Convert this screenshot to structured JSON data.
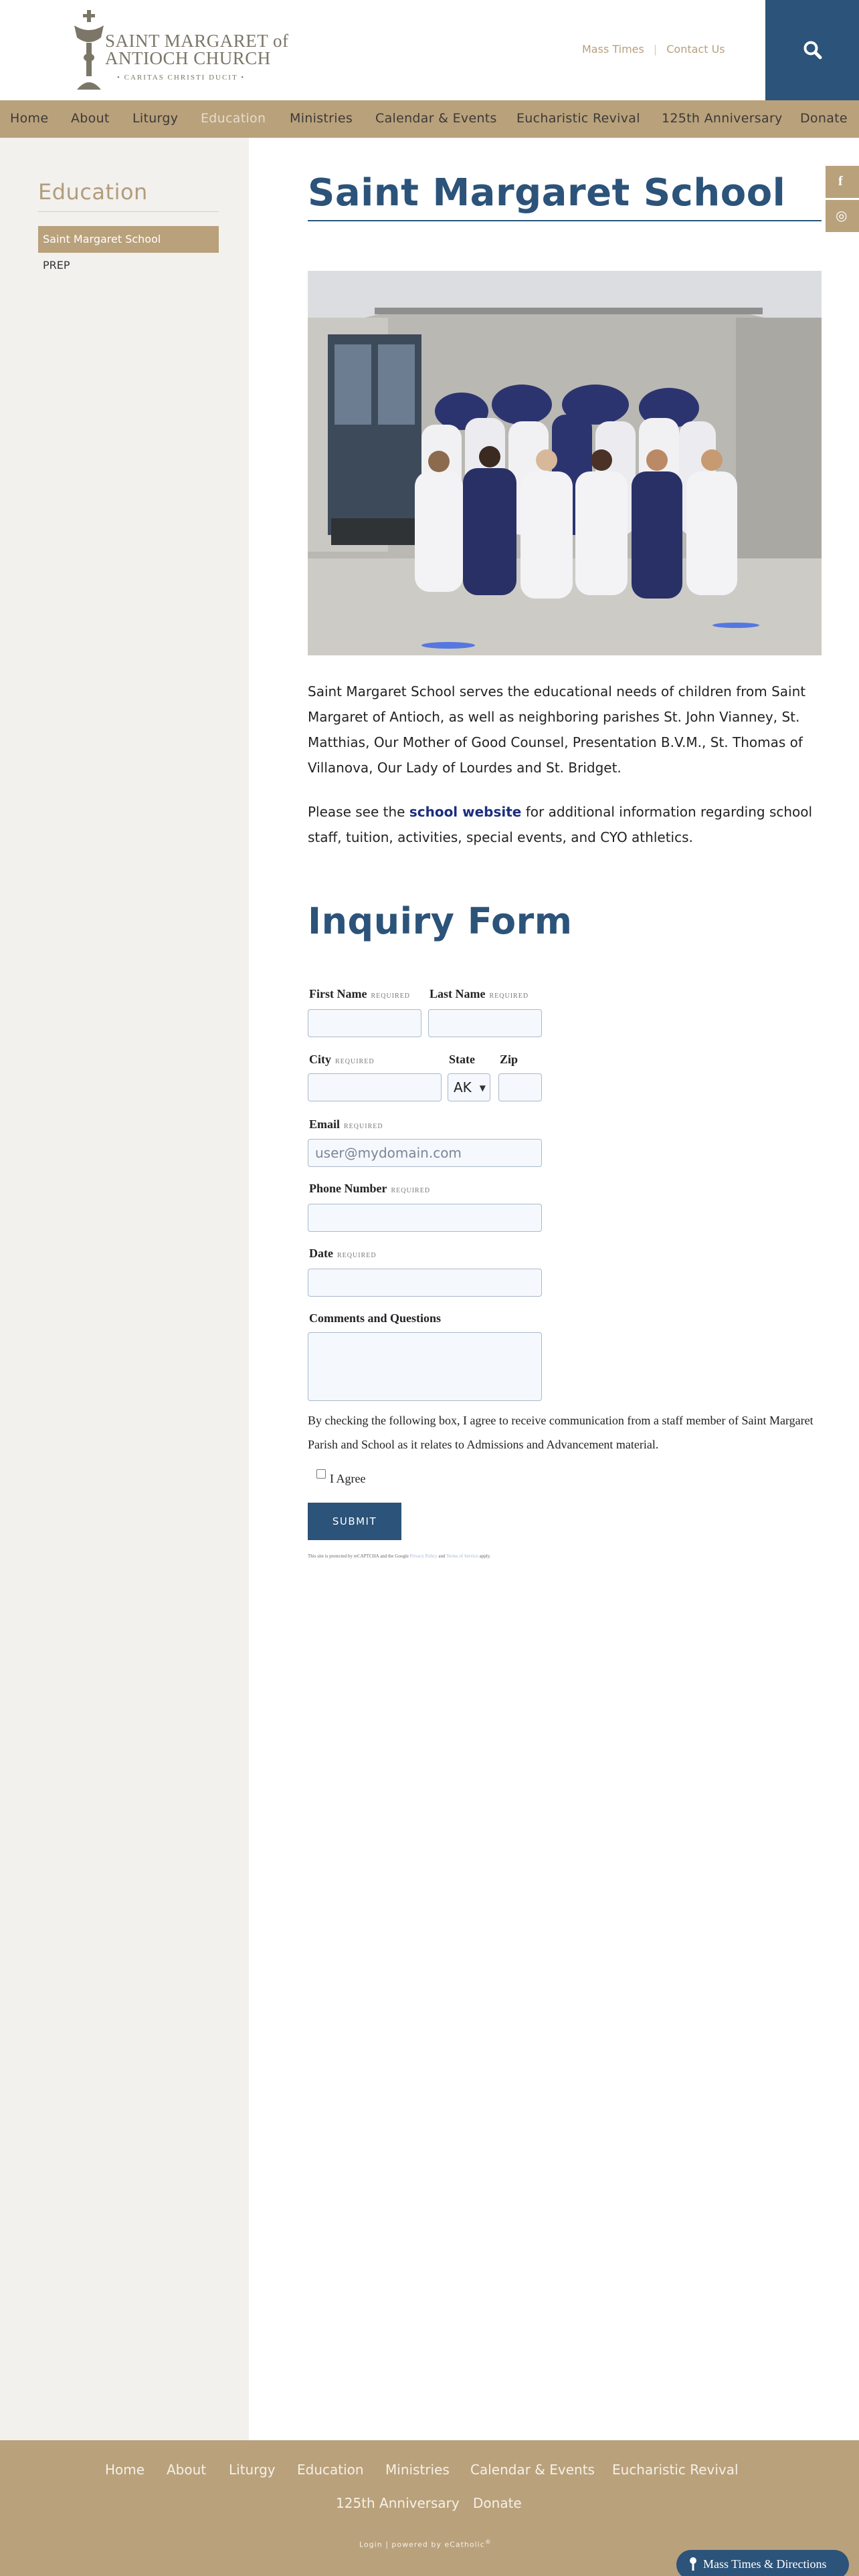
{
  "brand": {
    "line1": "SAINT MARGARET of",
    "line2": "ANTIOCH CHURCH",
    "tagline": "• CARITAS CHRISTI DUCIT •"
  },
  "top_links": {
    "mass_times": "Mass Times",
    "separator": "|",
    "contact": "Contact Us"
  },
  "nav": {
    "items": [
      "Home",
      "About",
      "Liturgy",
      "Education",
      "Ministries",
      "Calendar & Events",
      "Eucharistic Revival",
      "125th Anniversary",
      "Donate"
    ],
    "active": "Education"
  },
  "sidebar": {
    "title": "Education",
    "items": [
      "Saint Margaret School",
      "PREP"
    ],
    "active": "Saint Margaret School"
  },
  "social": {
    "icons": [
      "facebook-icon",
      "instagram-icon"
    ],
    "facebook_glyph": "f",
    "instagram_glyph": "◎"
  },
  "main": {
    "title": "Saint Margaret School",
    "paragraph1": "Saint Margaret School serves the educational needs of children from Saint Margaret of Antioch, as well as neighboring parishes St. John Vianney, St. Matthias, Our Mother of Good Counsel, Presentation B.V.M., St. Thomas of Villanova, Our Lady of Lourdes and St. Bridget.",
    "paragraph2_before": "Please see the ",
    "paragraph2_link": "school website",
    "paragraph2_after": " for additional information regarding school staff, tuition, activities, special events, and CYO athletics."
  },
  "form": {
    "title": "Inquiry Form",
    "required_tag": "REQUIRED",
    "first_name_label": "First Name",
    "last_name_label": "Last Name",
    "city_label": "City",
    "state_label": "State",
    "state_value": "AK",
    "zip_label": "Zip",
    "email_label": "Email",
    "email_placeholder": "user@mydomain.com",
    "phone_label": "Phone Number",
    "date_label": "Date",
    "comments_label": "Comments and Questions",
    "consent_text": "By checking the following box, I agree to receive communication from a staff member of Saint Margaret Parish and School as it relates to Admissions and Advancement material.",
    "agree_label": "I Agree",
    "submit_label": "SUBMIT",
    "recaptcha_before": "This site is protected by reCAPTCHA and the Google ",
    "recaptcha_privacy": "Privacy Policy",
    "recaptcha_and": " and ",
    "recaptcha_terms": "Terms of Service",
    "recaptcha_after": " apply."
  },
  "footer": {
    "row1": [
      "Home",
      "About",
      "Liturgy",
      "Education",
      "Ministries",
      "Calendar & Events",
      "Eucharistic Revival"
    ],
    "row2": [
      "125th Anniversary",
      "Donate"
    ],
    "login": "Login",
    "powered_sep": "|",
    "powered": "powered by eCatholic",
    "powered_mark": "®",
    "mass_pill": "Mass Times & Directions"
  },
  "colors": {
    "brand_navy": "#2c5379",
    "tan": "#b9a17c",
    "sidebar_bg": "#f2f1ee"
  }
}
